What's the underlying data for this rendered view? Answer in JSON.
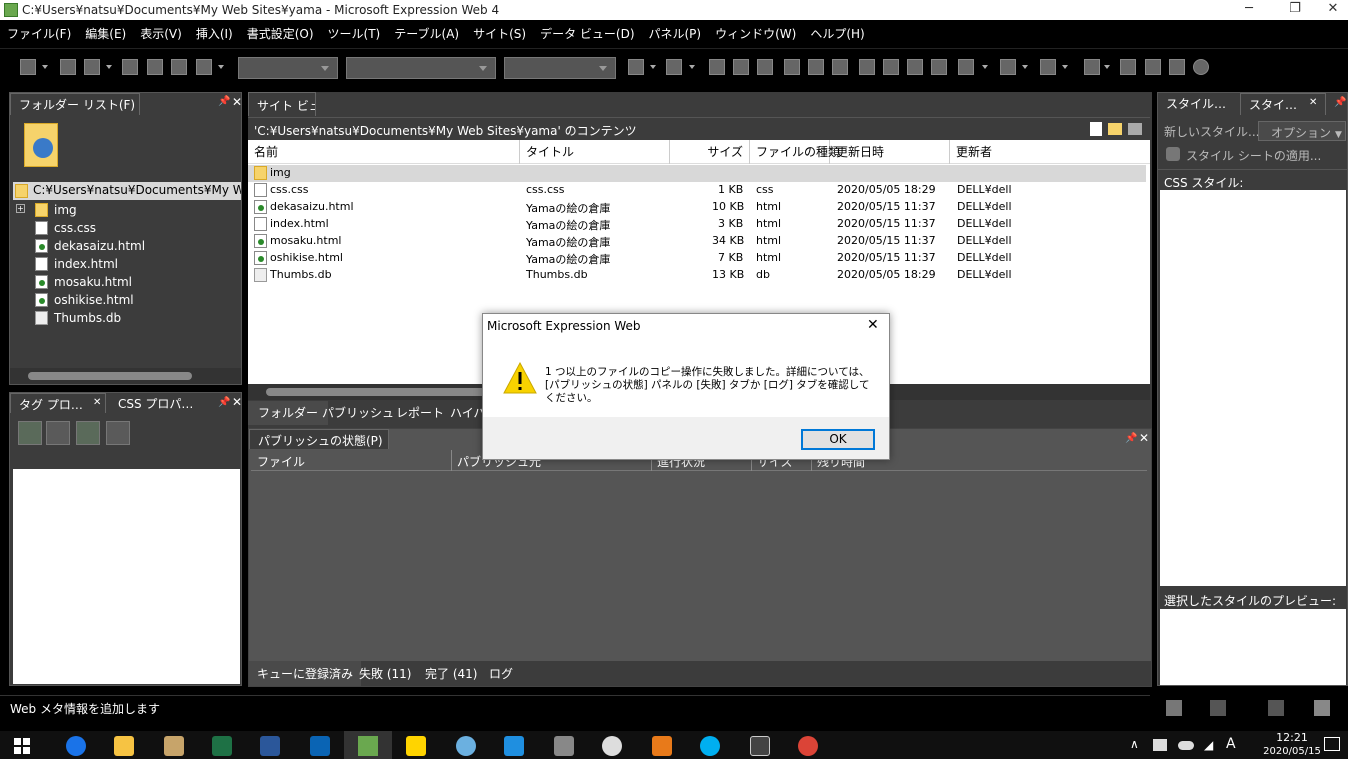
{
  "window": {
    "title": "C:¥Users¥natsu¥Documents¥My Web Sites¥yama - Microsoft Expression Web 4"
  },
  "menu": [
    "ファイル(F)",
    "編集(E)",
    "表示(V)",
    "挿入(I)",
    "書式設定(O)",
    "ツール(T)",
    "テーブル(A)",
    "サイト(S)",
    "データ ビュー(D)",
    "パネル(P)",
    "ウィンドウ(W)",
    "ヘルプ(H)"
  ],
  "folder_panel": {
    "title": "フォルダー リスト(F)",
    "root": "C:¥Users¥natsu¥Documents¥My Web Sit",
    "items": [
      "img",
      "css.css",
      "dekasaizu.html",
      "index.html",
      "mosaku.html",
      "oshikise.html",
      "Thumbs.db"
    ]
  },
  "tag_panel": {
    "tab1": "タグ プロ…",
    "tab2": "CSS プロパ…"
  },
  "site_view": {
    "tab": "サイト ビュー",
    "path": "'C:¥Users¥natsu¥Documents¥My Web Sites¥yama' のコンテンツ",
    "columns": [
      "名前",
      "タイトル",
      "サイズ",
      "ファイルの種類",
      "更新日時",
      "更新者"
    ],
    "folder_row": "img",
    "rows": [
      {
        "name": "css.css",
        "title": "css.css",
        "size": "1 KB",
        "type": "css",
        "date": "2020/05/05 18:29",
        "by": "DELL¥dell"
      },
      {
        "name": "dekasaizu.html",
        "title": "Yamaの絵の倉庫",
        "size": "10 KB",
        "type": "html",
        "date": "2020/05/15 11:37",
        "by": "DELL¥dell"
      },
      {
        "name": "index.html",
        "title": "Yamaの絵の倉庫",
        "size": "3 KB",
        "type": "html",
        "date": "2020/05/15 11:37",
        "by": "DELL¥dell"
      },
      {
        "name": "mosaku.html",
        "title": "Yamaの絵の倉庫",
        "size": "34 KB",
        "type": "html",
        "date": "2020/05/15 11:37",
        "by": "DELL¥dell"
      },
      {
        "name": "oshikise.html",
        "title": "Yamaの絵の倉庫",
        "size": "7 KB",
        "type": "html",
        "date": "2020/05/15 11:37",
        "by": "DELL¥dell"
      },
      {
        "name": "Thumbs.db",
        "title": "Thumbs.db",
        "size": "13 KB",
        "type": "db",
        "date": "2020/05/05 18:29",
        "by": "DELL¥dell"
      }
    ],
    "bottom_tabs": [
      "フォルダー",
      "パブリッシュ",
      "レポート",
      "ハイパー"
    ]
  },
  "publish_panel": {
    "title": "パブリッシュの状態(P)",
    "columns": [
      "ファイル",
      "パブリッシュ元",
      "進行状況",
      "サイズ",
      "残り時間"
    ],
    "tabs": [
      "キューに登録済み",
      "失敗 (11)",
      "完了 (41)",
      "ログ"
    ]
  },
  "styles_panel": {
    "tab1": "スタイル…",
    "tab2": "スタイ…",
    "new_style": "新しいスタイル...",
    "options": "オプション",
    "apply_sheet": "スタイル シートの適用...",
    "css_label": "CSS スタイル:",
    "preview_label": "選択したスタイルのプレビュー:"
  },
  "dialog": {
    "title": "Microsoft Expression Web",
    "message": "1 つ以上のファイルのコピー操作に失敗しました。詳細については、[パブリッシュの状態] パネルの [失敗] タブか [ログ] タブを確認してください。",
    "ok": "OK"
  },
  "statusbar": {
    "text": "Web メタ情報を追加します"
  },
  "taskbar": {
    "time": "12:21",
    "date": "2020/05/15",
    "ime": "A"
  }
}
